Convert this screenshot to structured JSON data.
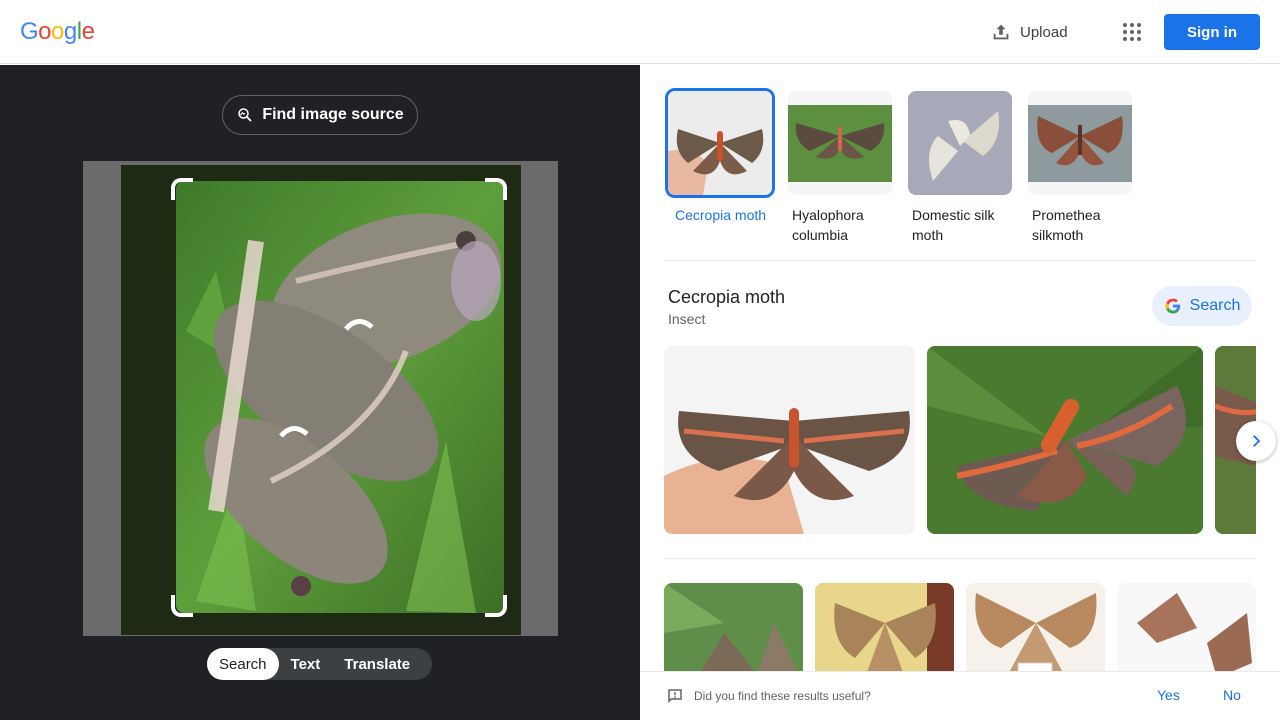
{
  "header": {
    "logo_letters": [
      "G",
      "o",
      "o",
      "g",
      "l",
      "e"
    ],
    "logo_colors": [
      "#4285F4",
      "#EA4335",
      "#FBBC05",
      "#4285F4",
      "#34A853",
      "#EA4335"
    ],
    "upload_label": "Upload",
    "signin_label": "Sign in",
    "accent": "#1a73e8"
  },
  "lens": {
    "find_source_label": "Find image source",
    "modes": [
      "Search",
      "Text",
      "Translate"
    ],
    "active_mode": "Search"
  },
  "related": [
    {
      "label": "Cecropia moth",
      "selected": true
    },
    {
      "label": "Hyalophora columbia",
      "selected": false
    },
    {
      "label": "Domestic silk moth",
      "selected": false
    },
    {
      "label": "Promethea silkmoth",
      "selected": false
    }
  ],
  "entity": {
    "title": "Cecropia moth",
    "subtitle": "Insect",
    "search_label": "Search"
  },
  "feedback": {
    "question": "Did you find these results useful?",
    "yes": "Yes",
    "no": "No"
  }
}
